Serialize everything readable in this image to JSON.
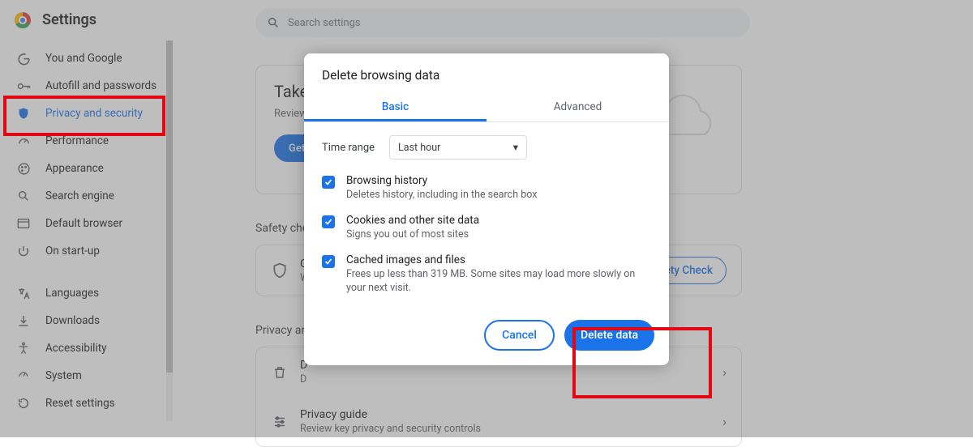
{
  "app_title": "Settings",
  "search_placeholder": "Search settings",
  "sidebar": {
    "items": [
      {
        "label": "You and Google"
      },
      {
        "label": "Autofill and passwords"
      },
      {
        "label": "Privacy and security"
      },
      {
        "label": "Performance"
      },
      {
        "label": "Appearance"
      },
      {
        "label": "Search engine"
      },
      {
        "label": "Default browser"
      },
      {
        "label": "On start-up"
      },
      {
        "label": "Languages"
      },
      {
        "label": "Downloads"
      },
      {
        "label": "Accessibility"
      },
      {
        "label": "System"
      },
      {
        "label": "Reset settings"
      }
    ]
  },
  "promo": {
    "title_visible": "Take",
    "subtitle_visible": "Review",
    "button_visible": "Get s"
  },
  "safety": {
    "section_label": "Safety che",
    "row_title": "Ch",
    "row_sub": "W",
    "button": "afety Check"
  },
  "privacy": {
    "section_label": "Privacy an",
    "rows": [
      {
        "title": "D",
        "sub": "D"
      },
      {
        "title": "Privacy guide",
        "sub": "Review key privacy and security controls"
      }
    ]
  },
  "dialog": {
    "title": "Delete browsing data",
    "tabs": [
      "Basic",
      "Advanced"
    ],
    "time_range_label": "Time range",
    "time_range_value": "Last hour",
    "options": [
      {
        "title": "Browsing history",
        "sub": "Deletes history, including in the search box"
      },
      {
        "title": "Cookies and other site data",
        "sub": "Signs you out of most sites"
      },
      {
        "title": "Cached images and files",
        "sub": "Frees up less than 319 MB. Some sites may load more slowly on your next visit."
      }
    ],
    "cancel": "Cancel",
    "confirm": "Delete data"
  }
}
